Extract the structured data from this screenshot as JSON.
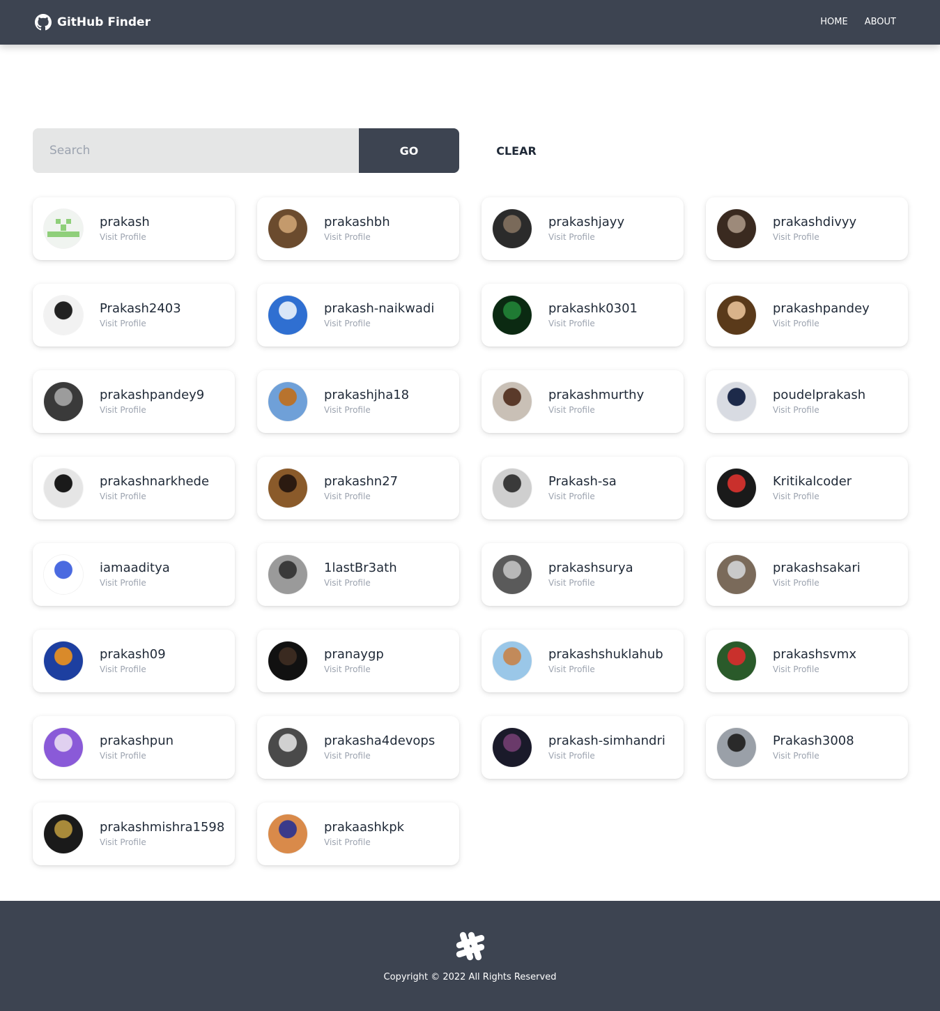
{
  "navbar": {
    "brand": "GitHub Finder",
    "links": [
      "HOME",
      "ABOUT"
    ]
  },
  "search": {
    "placeholder": "Search",
    "value": "",
    "go_label": "GO",
    "clear_label": "CLEAR"
  },
  "users": [
    {
      "login": "prakash",
      "link": "Visit Profile",
      "avatar": "identicon-green"
    },
    {
      "login": "prakashbh",
      "link": "Visit Profile",
      "avatar": "photo"
    },
    {
      "login": "prakashjayy",
      "link": "Visit Profile",
      "avatar": "photo"
    },
    {
      "login": "prakashdivyy",
      "link": "Visit Profile",
      "avatar": "photo"
    },
    {
      "login": "Prakash2403",
      "link": "Visit Profile",
      "avatar": "lion-drawing"
    },
    {
      "login": "prakash-naikwadi",
      "link": "Visit Profile",
      "avatar": "photo"
    },
    {
      "login": "prakashk0301",
      "link": "Visit Profile",
      "avatar": "matrix"
    },
    {
      "login": "prakashpandey",
      "link": "Visit Profile",
      "avatar": "photo"
    },
    {
      "login": "prakashpandey9",
      "link": "Visit Profile",
      "avatar": "photo"
    },
    {
      "login": "prakashjha18",
      "link": "Visit Profile",
      "avatar": "photo"
    },
    {
      "login": "prakashmurthy",
      "link": "Visit Profile",
      "avatar": "photo"
    },
    {
      "login": "poudelprakash",
      "link": "Visit Profile",
      "avatar": "photo"
    },
    {
      "login": "prakashnarkhede",
      "link": "Visit Profile",
      "avatar": "photo"
    },
    {
      "login": "prakashn27",
      "link": "Visit Profile",
      "avatar": "photo"
    },
    {
      "login": "Prakash-sa",
      "link": "Visit Profile",
      "avatar": "photo"
    },
    {
      "login": "Kritikalcoder",
      "link": "Visit Profile",
      "avatar": "photo"
    },
    {
      "login": "iamaaditya",
      "link": "Visit Profile",
      "avatar": "3d-plot"
    },
    {
      "login": "1lastBr3ath",
      "link": "Visit Profile",
      "avatar": "photo"
    },
    {
      "login": "prakashsurya",
      "link": "Visit Profile",
      "avatar": "emu-photo"
    },
    {
      "login": "prakashsakari",
      "link": "Visit Profile",
      "avatar": "photo"
    },
    {
      "login": "prakash09",
      "link": "Visit Profile",
      "avatar": "photo"
    },
    {
      "login": "pranaygp",
      "link": "Visit Profile",
      "avatar": "photo"
    },
    {
      "login": "prakashshuklahub",
      "link": "Visit Profile",
      "avatar": "photo"
    },
    {
      "login": "prakashsvmx",
      "link": "Visit Profile",
      "avatar": "photo"
    },
    {
      "login": "prakashpun",
      "link": "Visit Profile",
      "avatar": "photo"
    },
    {
      "login": "prakasha4devops",
      "link": "Visit Profile",
      "avatar": "photo"
    },
    {
      "login": "prakash-simhandri",
      "link": "Visit Profile",
      "avatar": "photo"
    },
    {
      "login": "Prakash3008",
      "link": "Visit Profile",
      "avatar": "photo"
    },
    {
      "login": "prakashmishra1598",
      "link": "Visit Profile",
      "avatar": "photo"
    },
    {
      "login": "prakaashkpk",
      "link": "Visit Profile",
      "avatar": "photo"
    }
  ],
  "footer": {
    "logo": "slack-like-hash-icon",
    "copyright": "Copyright © 2022 All Rights Reserved"
  },
  "colors": {
    "nav_bg": "#3d4451",
    "input_bg": "#e5e6e6",
    "text": "#1f2937",
    "muted": "#9ca3af"
  }
}
